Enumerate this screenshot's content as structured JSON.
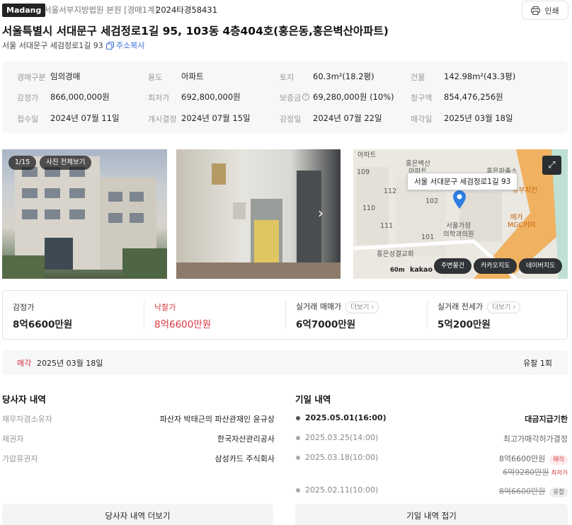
{
  "header": {
    "brand": "Madang",
    "court": "서울서부지방법원 본원 [경매1계]",
    "case_no": "2024타경58431",
    "print_label": "인쇄",
    "title": "서울특별시 서대문구 세검정로1길 95, 103동 4층404호(홍은동,홍은벽산아파트)",
    "sub_address": "서울 서대문구 세검정로1길 93",
    "copy_label": "주소복사"
  },
  "info": {
    "auction_type_label": "경매구분",
    "auction_type": "임의경매",
    "usage_label": "용도",
    "usage": "아파트",
    "land_label": "토지",
    "land": "60.3m²(18.2평)",
    "building_label": "건물",
    "building": "142.98m²(43.3평)",
    "appraisal_label": "감정가",
    "appraisal": "866,000,000원",
    "min_price_label": "최저가",
    "min_price": "692,800,000원",
    "deposit_label": "보증금",
    "deposit": "69,280,000원 (10%)",
    "claim_label": "청구액",
    "claim": "854,476,256원",
    "received_label": "접수일",
    "received": "2024년 07월 11일",
    "start_label": "개시결정",
    "start": "2024년 07월 15일",
    "appraisal_date_label": "감정일",
    "appraisal_date": "2024년 07월 22일",
    "sale_date_label": "매각일",
    "sale_date": "2025년 03월 18일"
  },
  "photos": {
    "counter": "1/15",
    "view_all": "사진 전체보기"
  },
  "map": {
    "tooltip": "서울 서대문구 세검정로1길 93",
    "labels": [
      "아파트",
      "홍은벽산",
      "아파트",
      "홍은파출소",
      "109",
      "112",
      "102",
      "110",
      "111",
      "101",
      "서울가정",
      "의학과의원",
      "메가",
      "MGC커피",
      "홍은성결교회",
      "뉴부치킨",
      "60m",
      "kakao"
    ],
    "btn_nearby": "주변물건",
    "btn_kakao": "카카오지도",
    "btn_naver": "네이버지도"
  },
  "prices": {
    "appraisal_label": "감정가",
    "appraisal": "8억6600만원",
    "winning_label": "낙찰가",
    "winning": "8억6600만원",
    "trade_label": "실거래 매매가",
    "trade": "6억7000만원",
    "rent_label": "실거래 전세가",
    "rent": "5억200만원",
    "more_label": "더보기",
    "accent_color": "#d9363e"
  },
  "status": {
    "label": "매각",
    "date": "2025년 03월 18일",
    "fail_count": "유찰 1회"
  },
  "parties": {
    "title": "당사자 내역",
    "rows": [
      {
        "label": "채무자겸소유자",
        "value": "파산자 박태근의 파산관재인 윤규상"
      },
      {
        "label": "채권자",
        "value": "한국자산관리공사"
      },
      {
        "label": "가압류권자",
        "value": "삼성카드 주식회사"
      }
    ],
    "more_button": "당사자 내역 더보기"
  },
  "schedule": {
    "title": "기일 내역",
    "rows": [
      {
        "date": "2025.05.01(16:00)",
        "result": "대금지급기한"
      },
      {
        "date": "2025.03.25(14:00)",
        "result": "최고가매각허가결정"
      },
      {
        "date": "2025.03.18(10:00)",
        "result": "8억6600만원",
        "tag": "매각",
        "sub": "6억9280만원",
        "sub_tag": "최저가"
      },
      {
        "date": "2025.02.11(10:00)",
        "result": "8억6600만원",
        "tag": "유찰"
      }
    ],
    "collapse_button": "기일 내역 접기"
  }
}
